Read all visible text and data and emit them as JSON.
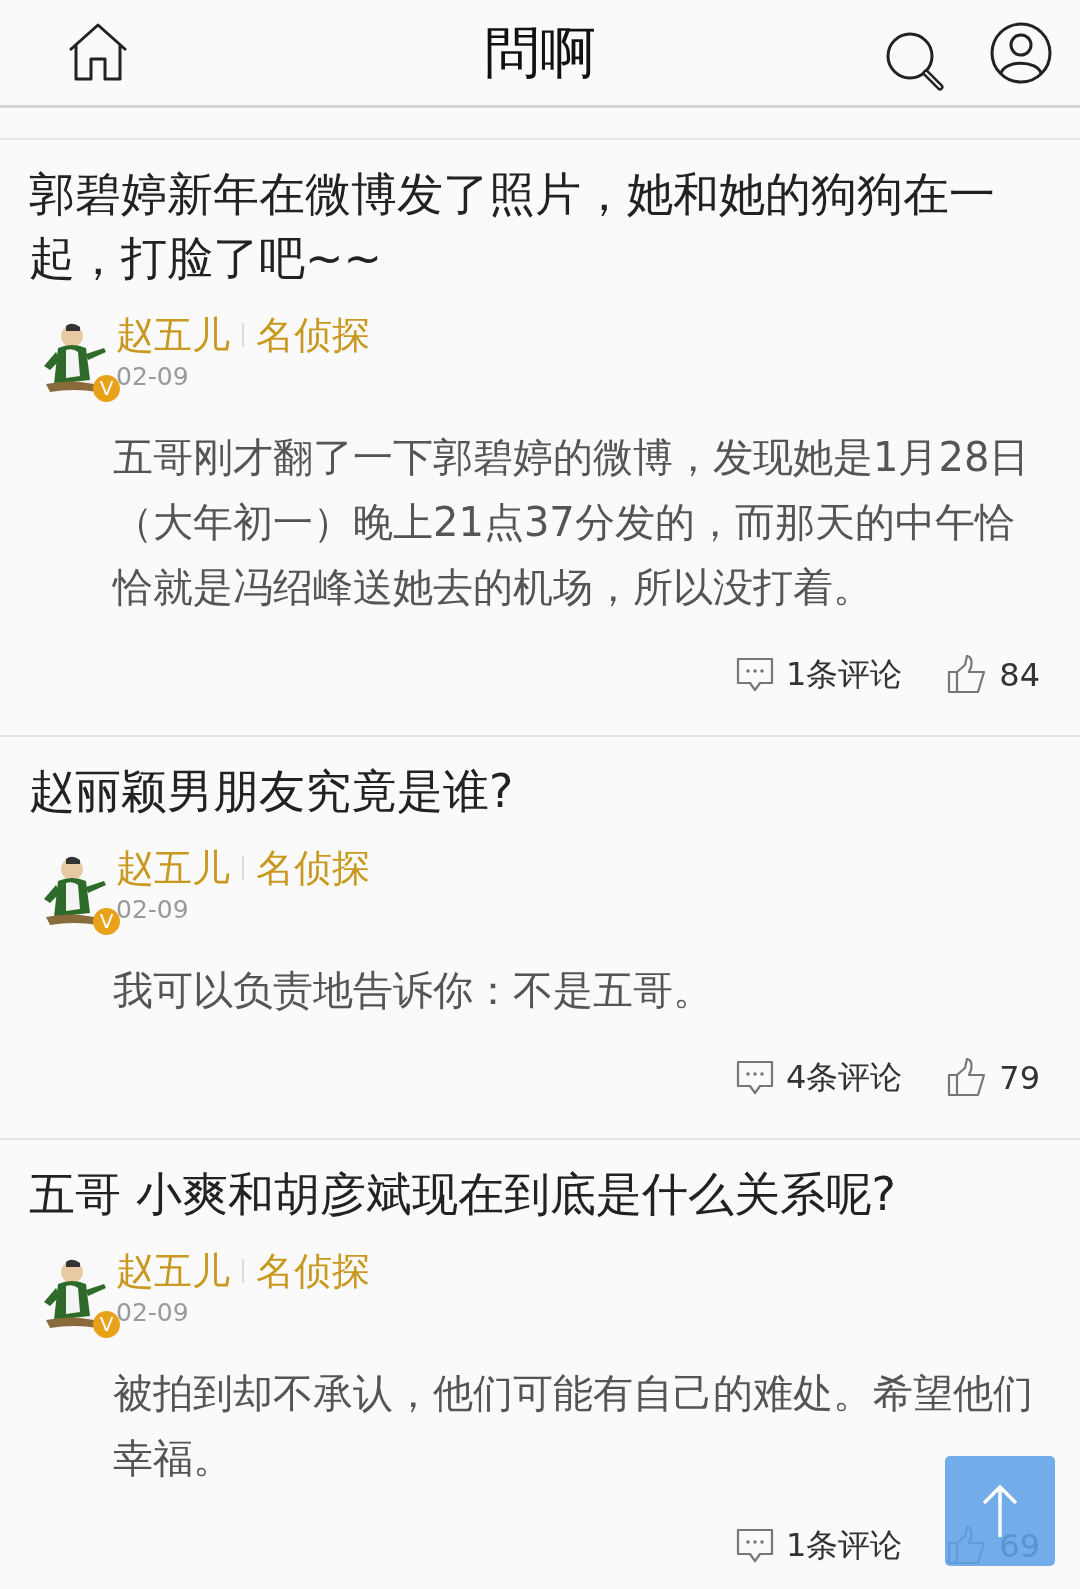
{
  "header": {
    "title": "問啊"
  },
  "posts": [
    {
      "title": "郭碧婷新年在微博发了照片，她和她的狗狗在一起，打脸了吧~~",
      "author": {
        "name": "赵五儿",
        "role": "名侦探",
        "badge": "V",
        "date": "02-09"
      },
      "answer": "五哥刚才翻了一下郭碧婷的微博，发现她是1月28日（大年初一）晚上21点37分发的，而那天的中午恰恰就是冯绍峰送她去的机场，所以没打着。",
      "comments": "1条评论",
      "likes": "84"
    },
    {
      "title": "赵丽颖男朋友究竟是谁?",
      "author": {
        "name": "赵五儿",
        "role": "名侦探",
        "badge": "V",
        "date": "02-09"
      },
      "answer": "我可以负责地告诉你：不是五哥。",
      "comments": "4条评论",
      "likes": "79"
    },
    {
      "title": "五哥 小爽和胡彦斌现在到底是什么关系呢?",
      "author": {
        "name": "赵五儿",
        "role": "名侦探",
        "badge": "V",
        "date": "02-09"
      },
      "answer": "被拍到却不承认，他们可能有自己的难处。希望他们幸福。",
      "comments": "1条评论",
      "likes": "69"
    }
  ]
}
